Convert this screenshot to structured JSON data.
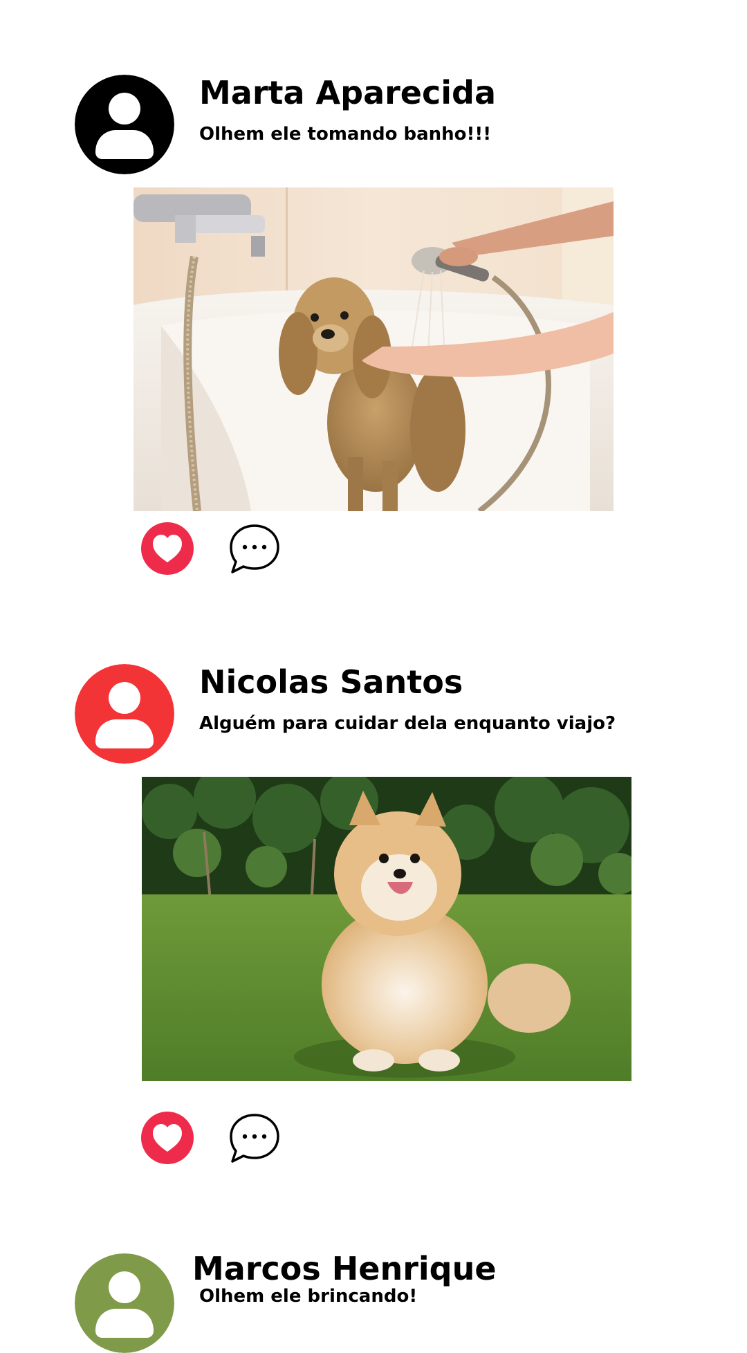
{
  "colors": {
    "like": "#ef2b4b",
    "avatar_marta": "#000000",
    "avatar_nicolas": "#f33436",
    "avatar_marcos": "#7f9a48"
  },
  "icons": {
    "avatar": "user-silhouette-icon",
    "like": "heart-icon",
    "comment": "speech-bubble-ellipsis-icon"
  },
  "posts": [
    {
      "author": "Marta Aparecida",
      "caption": "Olhem ele tomando banho!!!",
      "photo_subject": "dog-bath-photo"
    },
    {
      "author": "Nicolas Santos",
      "caption": "Alguém para cuidar dela enquanto viajo?",
      "photo_subject": "pomeranian-photo"
    },
    {
      "author": "Marcos Henrique",
      "caption": "Olhem ele brincando!"
    }
  ]
}
